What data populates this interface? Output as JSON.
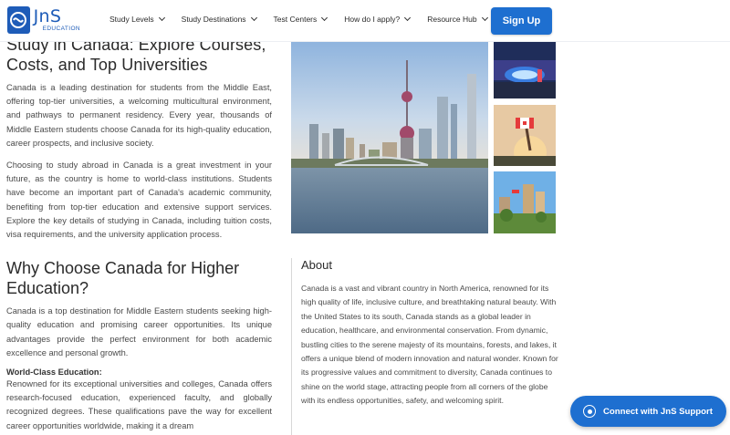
{
  "header": {
    "logo_name": "JnS",
    "logo_sub": "EDUCATION",
    "nav": [
      {
        "label": "Study Levels"
      },
      {
        "label": "Study Destinations"
      },
      {
        "label": "Test Centers"
      },
      {
        "label": "How do I apply?"
      },
      {
        "label": "Resource Hub"
      }
    ],
    "signup_label": "Sign Up"
  },
  "main": {
    "title": "Study in Canada: Explore Courses, Costs, and Top Universities",
    "intro_p1": "Canada is a leading destination for students from the Middle East, offering top-tier universities, a welcoming multicultural environment, and pathways to permanent residency. Every year, thousands of Middle Eastern students choose Canada for its high-quality education, career prospects, and inclusive society.",
    "intro_p2": "Choosing to study abroad in Canada is a great investment in your future, as the country is home to world-class institutions. Students have become an important part of Canada's academic community, benefiting from top-tier education and extensive support services. Explore the key details of studying in Canada, including tuition costs, visa requirements, and the university application process.",
    "why_title": "Why Choose Canada for Higher Education?",
    "why_p": "Canada is a top destination for Middle Eastern students seeking high-quality education and promising career opportunities. Its unique advantages provide the perfect environment for both academic excellence and personal growth.",
    "world_class_title": "World-Class Education:",
    "world_class_p": "Renowned for its exceptional universities and colleges, Canada offers research-focused education, experienced faculty, and globally recognized degrees. These qualifications pave the way for excellent career opportunities worldwide, making it a dream"
  },
  "about": {
    "title": "About",
    "text": "Canada is a vast and vibrant country in North America, renowned for its high quality of life, inclusive culture, and breathtaking natural beauty. With the United States to its south, Canada stands as a global leader in education, healthcare, and environmental conservation. From dynamic, bustling cities to the serene majesty of its mountains, forests, and lakes, it offers a unique blend of modern innovation and natural wonder. Known for its progressive values and commitment to diversity, Canada continues to shine on the world stage, attracting people from all corners of the globe with its endless opportunities, safety, and welcoming spirit."
  },
  "support": {
    "label": "Connect with JnS Support"
  },
  "colors": {
    "brand": "#1e5cb8",
    "button": "#1e6fd0"
  },
  "icons": [
    "jns-logo-icon",
    "chevron-down-icon",
    "whatsapp-icon"
  ]
}
